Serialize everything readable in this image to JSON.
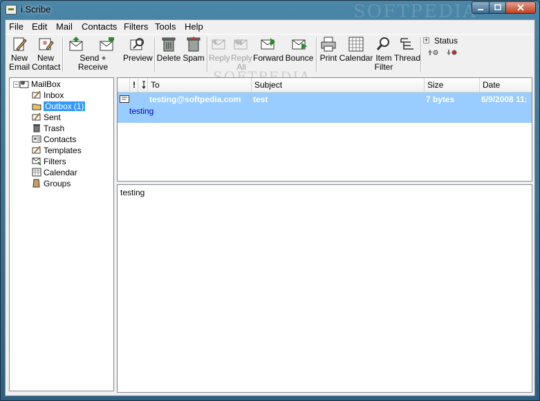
{
  "window": {
    "title": "i.Scribe",
    "watermark": "SOFTPEDIA"
  },
  "menu": [
    "File",
    "Edit",
    "Mail",
    "Contacts",
    "Filters",
    "Tools",
    "Help"
  ],
  "toolbar": {
    "new_email": [
      "New",
      "Email"
    ],
    "new_contact": [
      "New",
      "Contact"
    ],
    "send_receive": "Send + Receive",
    "preview": "Preview",
    "delete": "Delete",
    "spam": "Spam",
    "reply": "Reply",
    "reply_all": [
      "Reply",
      "All"
    ],
    "forward": "Forward",
    "bounce": "Bounce",
    "print": "Print",
    "calendar": "Calendar",
    "item_filter": [
      "Item",
      "Filter"
    ],
    "thread": "Thread",
    "status": "Status"
  },
  "folders": {
    "root": "MailBox",
    "items": [
      {
        "label": "Inbox",
        "count": ""
      },
      {
        "label": "Outbox",
        "count": "(1)"
      },
      {
        "label": "Sent",
        "count": ""
      },
      {
        "label": "Trash",
        "count": ""
      },
      {
        "label": "Contacts",
        "count": ""
      },
      {
        "label": "Templates",
        "count": ""
      },
      {
        "label": "Filters",
        "count": ""
      },
      {
        "label": "Calendar",
        "count": ""
      },
      {
        "label": "Groups",
        "count": ""
      }
    ]
  },
  "list": {
    "headers": {
      "flag": "!",
      "to": "To",
      "subject": "Subject",
      "size": "Size",
      "date": "Date"
    },
    "rows": [
      {
        "to": "testing@softpedia.com",
        "subject": "test",
        "size": "7 bytes",
        "date": "6/9/2008 11:",
        "preview": "testing"
      }
    ]
  },
  "preview_body": "testing",
  "colors": {
    "selection": "#99ccff",
    "tree_selection": "#3399ff",
    "count_color": "#0000ff"
  }
}
